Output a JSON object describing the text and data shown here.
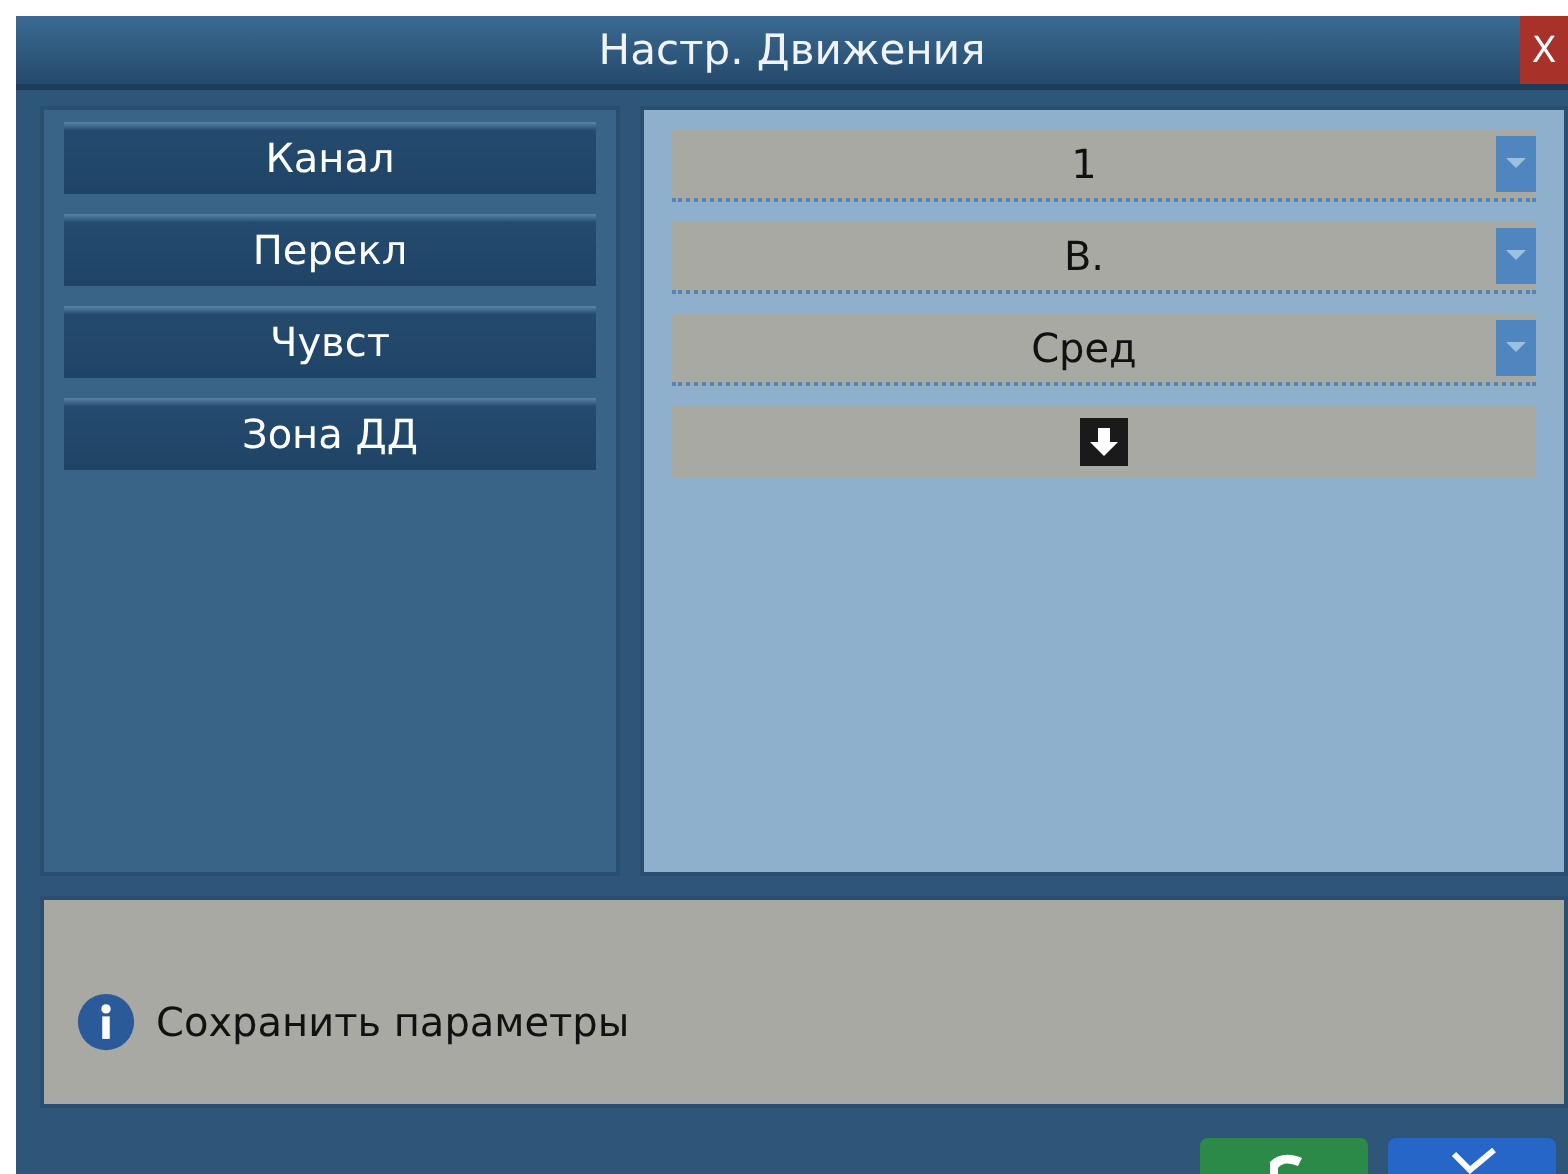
{
  "window": {
    "title": "Настр. Движения",
    "close": "X"
  },
  "settings": [
    {
      "label": "Канал",
      "kind": "dropdown",
      "value": "1"
    },
    {
      "label": "Перекл",
      "kind": "dropdown",
      "value": "В."
    },
    {
      "label": "Чувст",
      "kind": "dropdown",
      "value": "Сред"
    },
    {
      "label": "Зона ДД",
      "kind": "action"
    }
  ],
  "info": {
    "message": "Сохранить параметры"
  },
  "footer_buttons": [
    {
      "kind": "back"
    },
    {
      "kind": "confirm"
    }
  ]
}
